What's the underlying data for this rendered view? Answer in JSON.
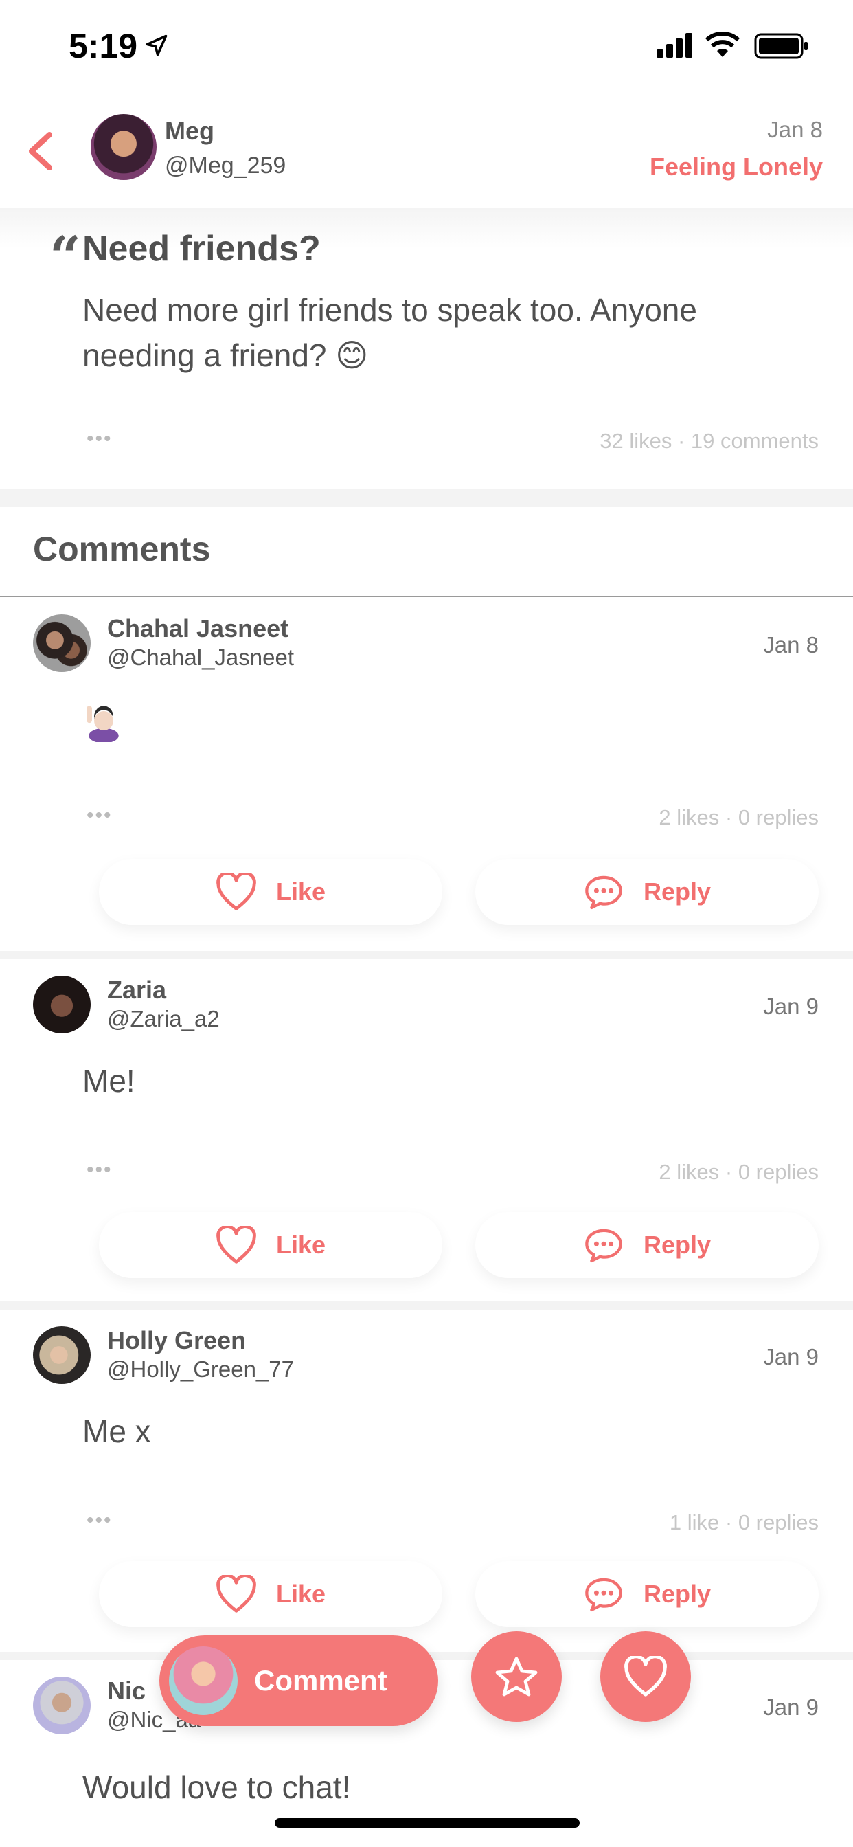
{
  "status_bar": {
    "time": "5:19"
  },
  "post": {
    "author_name": "Meg",
    "author_handle": "@Meg_259",
    "date": "Jan 8",
    "mood": "Feeling Lonely",
    "quote_mark": "“",
    "title": "Need friends?",
    "body": "Need more girl friends to speak too. Anyone needing a friend? 😊",
    "more": "•••",
    "stats": "32 likes · 19 comments"
  },
  "comments_section": {
    "title": "Comments"
  },
  "comments": [
    {
      "name": "Chahal Jasneet",
      "handle": "@Chahal_Jasneet",
      "date": "Jan 8",
      "text": "",
      "stats": "2 likes · 0 replies",
      "more": "•••",
      "like_label": "Like",
      "reply_label": "Reply"
    },
    {
      "name": "Zaria",
      "handle": "@Zaria_a2",
      "date": "Jan 9",
      "text": "Me!",
      "stats": "2 likes · 0 replies",
      "more": "•••",
      "like_label": "Like",
      "reply_label": "Reply"
    },
    {
      "name": "Holly Green",
      "handle": "@Holly_Green_77",
      "date": "Jan 9",
      "text": "Me x",
      "stats": "1 like · 0 replies",
      "more": "•••",
      "like_label": "Like",
      "reply_label": "Reply"
    },
    {
      "name": "Nic",
      "handle": "@Nic_aa",
      "date": "Jan 9",
      "text": "Would love to chat!"
    }
  ],
  "action_bar": {
    "comment_label": "Comment"
  },
  "colors": {
    "accent": "#f26f6f",
    "fab": "#f47878",
    "text": "#505050",
    "muted": "#c6c6c6"
  },
  "icons": [
    "back-chevron-icon",
    "location-arrow-icon",
    "signal-icon",
    "wifi-icon",
    "battery-icon",
    "heart-icon",
    "speech-bubble-icon",
    "star-icon"
  ]
}
